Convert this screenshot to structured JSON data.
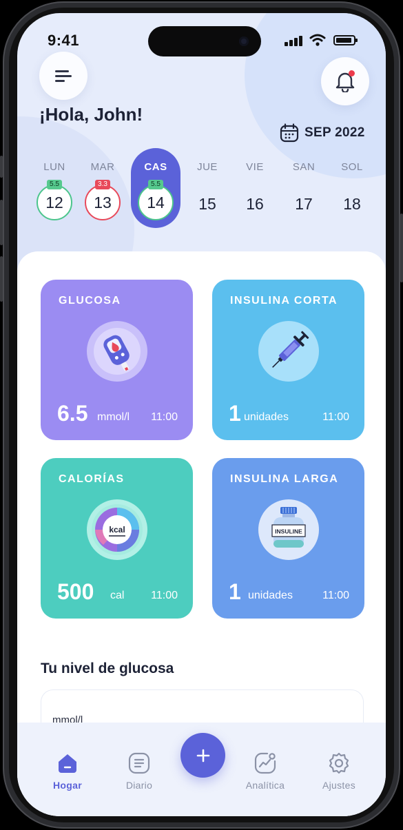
{
  "status_bar": {
    "time": "9:41"
  },
  "header": {
    "greeting": "¡Hola, John!",
    "month": "SEP 2022"
  },
  "week": {
    "days": [
      {
        "label": "LUN",
        "number": "12",
        "badge": "5.5",
        "badge_color": "#56c98e",
        "ring_color": "#4cc58c"
      },
      {
        "label": "MAR",
        "number": "13",
        "badge": "3.3",
        "badge_color": "#e8495a",
        "ring_color": "#e8495a"
      },
      {
        "label": "CAS",
        "number": "14",
        "badge": "5.5",
        "badge_color": "#56c98e",
        "ring_color": "#4cc58c",
        "active": true
      },
      {
        "label": "JUE",
        "number": "15"
      },
      {
        "label": "VIE",
        "number": "16"
      },
      {
        "label": "SAN",
        "number": "17"
      },
      {
        "label": "SOL",
        "number": "18"
      }
    ]
  },
  "tiles": {
    "glucose": {
      "title": "GLUCOSA",
      "value": "6.5",
      "unit": "mmol/l",
      "time": "11:00",
      "icon": "glucometer-icon",
      "color": "#9b8cf2"
    },
    "short_insulin": {
      "title": "INSULINA CORTA",
      "value": "1",
      "unit": "unidades",
      "time": "11:00",
      "icon": "syringe-icon",
      "color": "#5bbfee"
    },
    "calories": {
      "title": "CALORÍAS",
      "value": "500",
      "unit": "cal",
      "time": "11:00",
      "icon": "kcal-icon",
      "icon_text": "kcal",
      "color": "#4dcdbf"
    },
    "long_insulin": {
      "title": "INSULINA LARGA",
      "value": "1",
      "unit": "unidades",
      "time": "11:00",
      "icon": "insulin-vial-icon",
      "icon_text": "INSULINE",
      "color": "#6a9ded"
    }
  },
  "glucose_section": {
    "title": "Tu nivel de glucosa",
    "unit": "mmol/l"
  },
  "tabbar": {
    "items": [
      {
        "label": "Hogar",
        "icon": "home-icon",
        "active": true
      },
      {
        "label": "Diario",
        "icon": "diary-icon"
      },
      {
        "label": "Analítica",
        "icon": "analytics-icon"
      },
      {
        "label": "Ajustes",
        "icon": "settings-icon"
      }
    ],
    "add_icon": "plus-icon"
  },
  "colors": {
    "accent": "#5b62d9",
    "positive": "#56c98e",
    "negative": "#e8495a"
  }
}
